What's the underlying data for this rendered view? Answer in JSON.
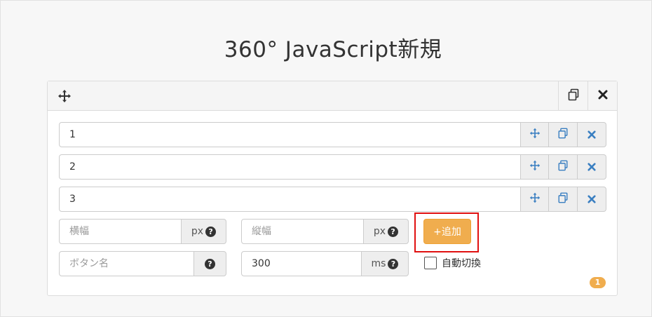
{
  "page": {
    "title": "360° JavaScript新規"
  },
  "panel": {
    "header": {
      "move_icon": "arrows-move-icon",
      "copy_icon": "copy-icon",
      "close_icon": "close-x-icon"
    },
    "items": [
      {
        "value": "1"
      },
      {
        "value": "2"
      },
      {
        "value": "3"
      }
    ],
    "width_field": {
      "placeholder": "横幅",
      "value": "",
      "unit": "px"
    },
    "height_field": {
      "placeholder": "縦幅",
      "value": "",
      "unit": "px"
    },
    "button_name_field": {
      "placeholder": "ボタン名",
      "value": ""
    },
    "interval_field": {
      "value": "300",
      "unit": "ms"
    },
    "add_button": {
      "label": "+追加"
    },
    "auto_switch": {
      "label": "自動切換",
      "checked": false
    },
    "badge": {
      "count": "1"
    }
  },
  "colors": {
    "accent_orange": "#f0ad4e",
    "icon_blue": "#3a7fc1",
    "highlight_red": "#e01010"
  }
}
